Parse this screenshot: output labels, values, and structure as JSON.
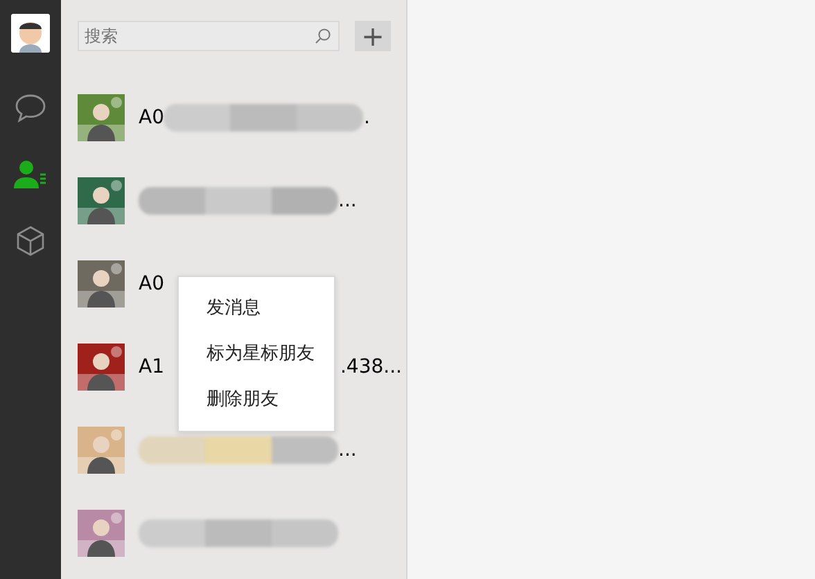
{
  "sidebar": {
    "items": [
      {
        "kind": "chat",
        "selected": false
      },
      {
        "kind": "contacts",
        "selected": true
      },
      {
        "kind": "box",
        "selected": false
      }
    ]
  },
  "search": {
    "placeholder": "搜索",
    "add_button": "+"
  },
  "contacts": [
    {
      "prefix": "A0",
      "tail": ".",
      "blurred": true
    },
    {
      "suffix": "...",
      "blurred": true
    },
    {
      "prefix": "A0",
      "blurred": false
    },
    {
      "prefix": "A1",
      "suffix": ".438...",
      "blurred": false
    },
    {
      "suffix": "...",
      "blurred": true
    },
    {
      "blurred": true
    }
  ],
  "context_menu": [
    "发消息",
    "标为星标朋友",
    "删除朋友"
  ]
}
